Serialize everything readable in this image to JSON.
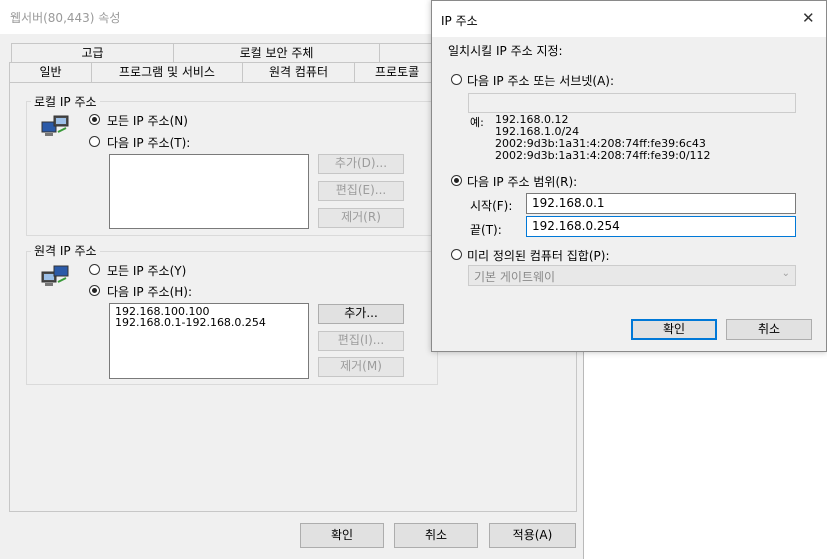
{
  "props_window": {
    "title": "웹서버(80,443) 속성",
    "tabs_row1": [
      "고급",
      "로컬 보안 주체",
      ""
    ],
    "tabs_row2": [
      "일반",
      "프로그램 및 서비스",
      "원격 컴퓨터",
      "프로토콜 및"
    ],
    "local": {
      "group_label": "로컬 IP 주소",
      "radio_any": "모든 IP 주소(N)",
      "radio_these": "다음 IP 주소(T):",
      "selected": "any",
      "add": "추가(D)...",
      "edit": "편집(E)...",
      "remove": "제거(R)"
    },
    "remote": {
      "group_label": "원격 IP 주소",
      "radio_any": "모든 IP 주소(Y)",
      "radio_these": "다음 IP 주소(H):",
      "selected": "these",
      "list": [
        "192.168.100.100",
        "192.168.0.1-192.168.0.254"
      ],
      "add": "추가...",
      "edit": "편집(I)...",
      "remove": "제거(M)"
    },
    "ok": "확인",
    "cancel": "취소",
    "apply": "적용(A)"
  },
  "ip_dialog": {
    "title": "IP 주소",
    "close_glyph": "✕",
    "heading": "일치시킬 IP 주소 지정:",
    "radio_subnet": "다음 IP 주소 또는 서브넷(A):",
    "subnet_value": "",
    "example_label": "예:",
    "examples": [
      "192.168.0.12",
      "192.168.1.0/24",
      "2002:9d3b:1a31:4:208:74ff:fe39:6c43",
      "2002:9d3b:1a31:4:208:74ff:fe39:0/112"
    ],
    "radio_range": "다음 IP 주소 범위(R):",
    "start_label": "시작(F):",
    "start_value": "192.168.0.1",
    "end_label": "끝(T):",
    "end_value": "192.168.0.254",
    "radio_predefined": "미리 정의된 컴퓨터 집합(P):",
    "predefined_value": "기본 게이트웨이",
    "selected": "range",
    "ok": "확인",
    "cancel": "취소"
  },
  "colors": {
    "accent": "#0078d7"
  }
}
